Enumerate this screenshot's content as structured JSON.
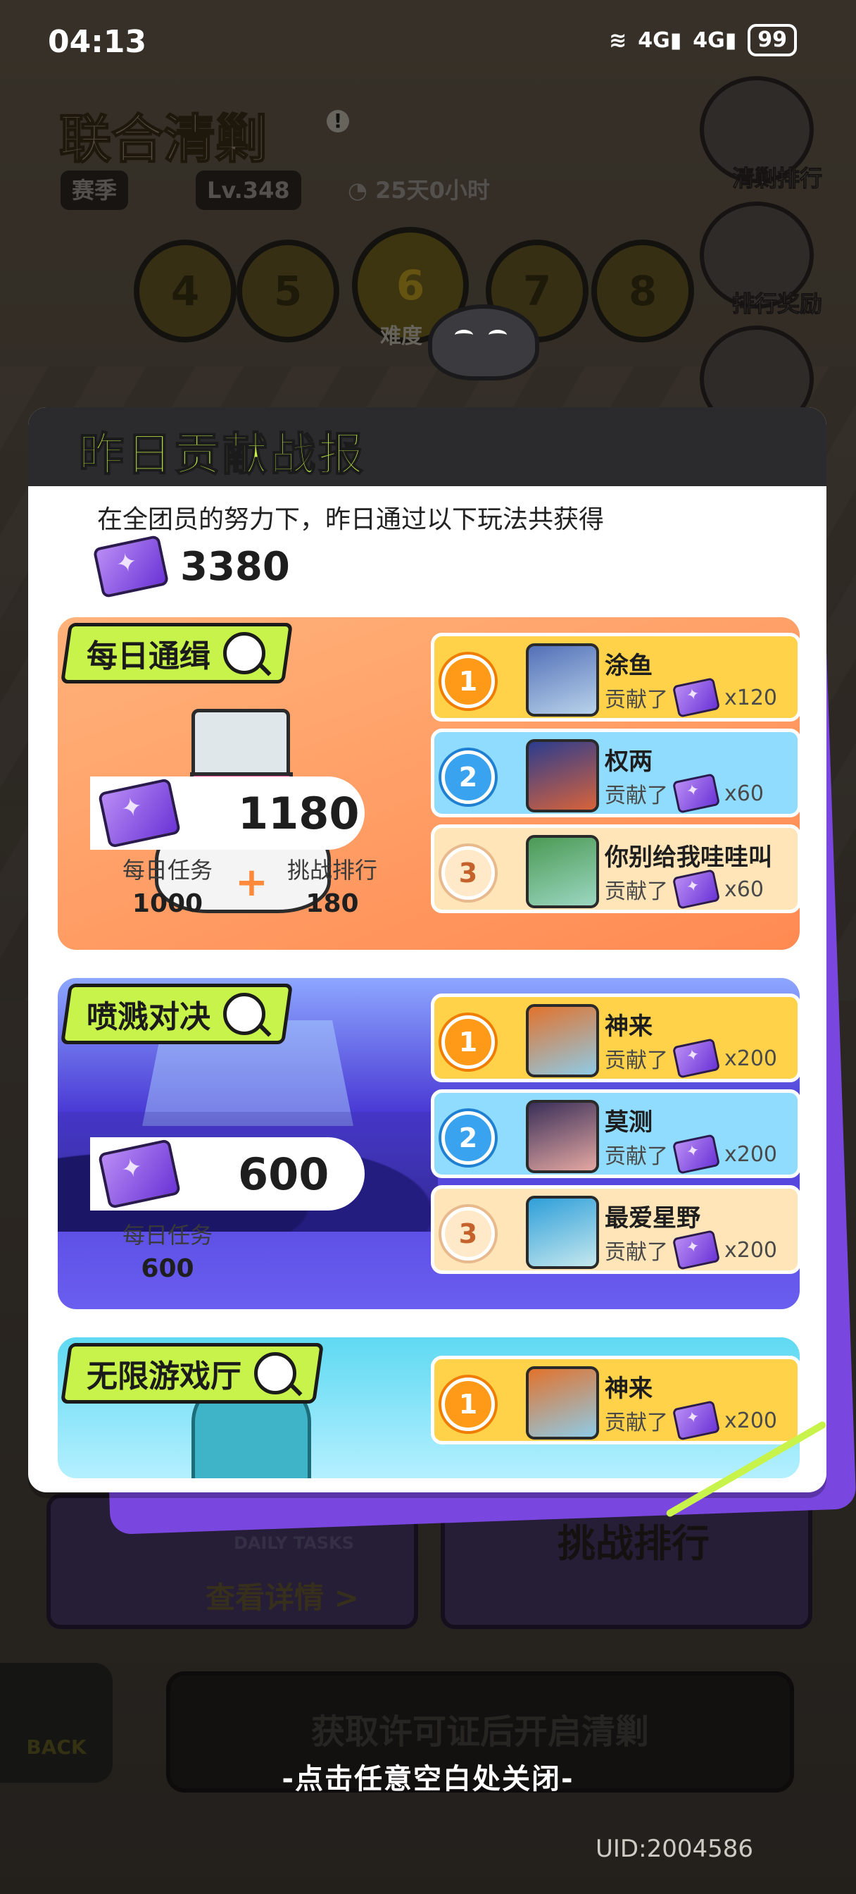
{
  "status": {
    "time": "04:13",
    "net1": "4G",
    "net2": "4G",
    "battery": "99"
  },
  "background": {
    "title_a": "联合",
    "title_b": "清剿",
    "season": "赛季",
    "level": "Lv.348",
    "timer": "25天0小时",
    "levels": [
      "4",
      "5",
      "6",
      "7",
      "8"
    ],
    "difficulty": "难度",
    "side_buttons": [
      "清剿排行",
      "排行奖励"
    ],
    "card_daily_en": "DAILY TASKS",
    "card_detail": "查看详情 >",
    "card_right_label": "挑战排行",
    "start_button": "获取许可证后开启清剿",
    "back_label": "BACK",
    "close_hint": "-点击任意空白处关闭-",
    "uid": "UID:2004586"
  },
  "popup": {
    "title": "昨日贡献战报",
    "intro": "在全团员的努力下，昨日通过以下玩法共获得",
    "total": "3380",
    "contributed_label": "贡献了",
    "sections": [
      {
        "name": "每日通缉",
        "value": "1180",
        "subs": [
          {
            "label": "每日任务",
            "value": "1000"
          },
          {
            "label": "挑战排行",
            "value": "180"
          }
        ],
        "ranks": [
          {
            "rank": "1",
            "name": "涂鱼",
            "amount": "x120"
          },
          {
            "rank": "2",
            "name": "权两",
            "amount": "x60"
          },
          {
            "rank": "3",
            "name": "你别给我哇哇叫",
            "amount": "x60"
          }
        ]
      },
      {
        "name": "喷溅对决",
        "value": "600",
        "subs": [
          {
            "label": "每日任务",
            "value": "600"
          }
        ],
        "ranks": [
          {
            "rank": "1",
            "name": "神来",
            "amount": "x200"
          },
          {
            "rank": "2",
            "name": "莫测",
            "amount": "x200"
          },
          {
            "rank": "3",
            "name": "最爱星野",
            "amount": "x200"
          }
        ]
      },
      {
        "name": "无限游戏厅",
        "ranks": [
          {
            "rank": "1",
            "name": "神来",
            "amount": "x200"
          }
        ]
      }
    ]
  },
  "colors": {
    "accent_lime": "#c7f34a",
    "purple": "#7a46e0",
    "orange": "#ff8a52"
  }
}
